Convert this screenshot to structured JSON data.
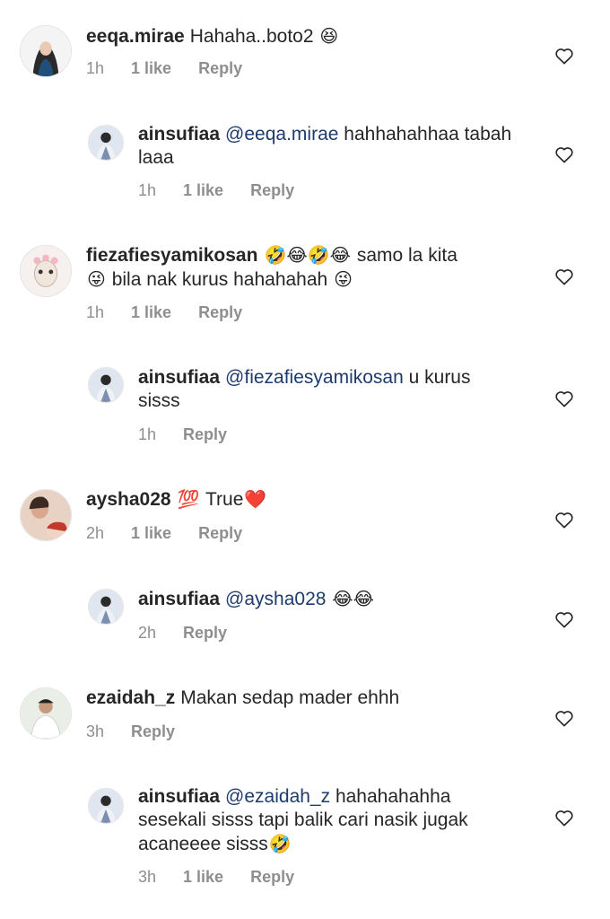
{
  "comments": [
    {
      "username": "eeqa.mirae",
      "text": "Hahaha..boto2",
      "emoji_after": "😆",
      "time": "1h",
      "likes": "1 like",
      "reply": "Reply"
    },
    {
      "username": "ainsufiaa",
      "mention": "@eeqa.mirae",
      "text": "hahhahahhaa tabah laaa",
      "time": "1h",
      "likes": "1 like",
      "reply": "Reply"
    },
    {
      "username": "fiezafiesyamikosan",
      "emojis": "🤣😂🤣😂",
      "text": "samo la kita",
      "emoji_mid": "😜",
      "text2": "bila nak kurus hahahahah",
      "emoji_end": "😜",
      "time": "1h",
      "likes": "1 like",
      "reply": "Reply"
    },
    {
      "username": "ainsufiaa",
      "mention": "@fiezafiesyamikosan",
      "text": "u kurus sisss",
      "time": "1h",
      "reply": "Reply"
    },
    {
      "username": "aysha028",
      "emoji_before": "💯",
      "text": "True",
      "emoji_after": "❤️",
      "time": "2h",
      "likes": "1 like",
      "reply": "Reply"
    },
    {
      "username": "ainsufiaa",
      "mention": "@aysha028",
      "emoji_after": "😂😂",
      "time": "2h",
      "reply": "Reply"
    },
    {
      "username": "ezaidah_z",
      "text": "Makan sedap mader ehhh",
      "time": "3h",
      "reply": "Reply"
    },
    {
      "username": "ainsufiaa",
      "mention": "@ezaidah_z",
      "text": "hahahahahha sesekali sisss tapi balik cari nasik jugak acaneeee sisss",
      "emoji_after": "🤣",
      "time": "3h",
      "likes": "1 like",
      "reply": "Reply"
    }
  ],
  "icons": {
    "heart": "heart-outline-icon"
  },
  "colors": {
    "text": "#262626",
    "meta": "#8e8e8e",
    "mention": "#1d3b6e",
    "border": "#e3e3e3"
  }
}
